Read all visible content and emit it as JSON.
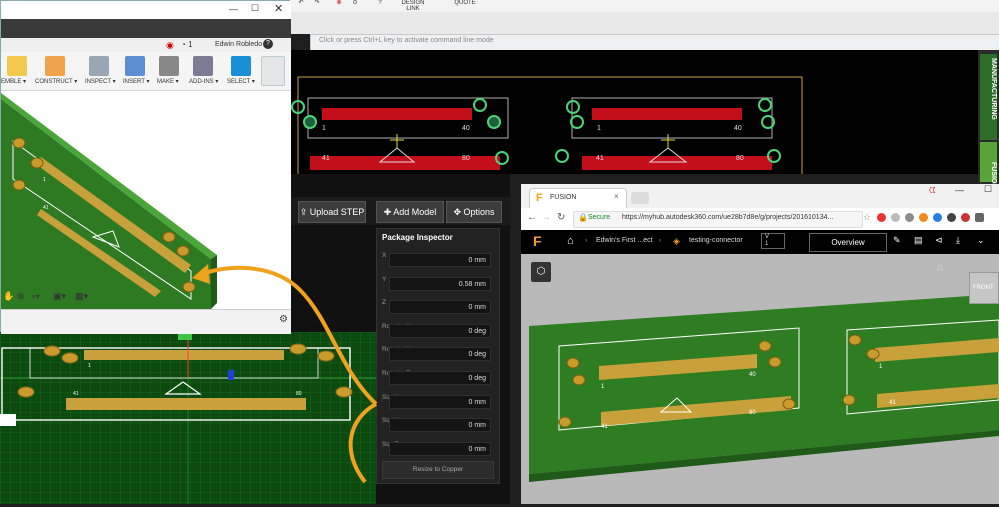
{
  "eagle": {
    "toolbar": {
      "design_link": "DESIGN\nLINK",
      "quote": "QUOTE"
    },
    "command_placeholder": "Click or press Ctrl+L key to activate command line mode",
    "board_pins_top": [
      "1",
      "40"
    ],
    "board_pins_bottom": [
      "41",
      "80"
    ],
    "side_tabs": {
      "manufacturing": "MANUFACTURING",
      "fusion": "FUSION"
    }
  },
  "fusion": {
    "user_name": "Edwin Robledo",
    "job_count": "1",
    "help": "?",
    "ribbon": [
      "EMBLE ▾",
      "CONSTRUCT ▾",
      "INSPECT ▾",
      "INSERT ▾",
      "MAKE ▾",
      "ADD-INS ▾",
      "SELECT ▾"
    ],
    "model_pins": {
      "a": "1",
      "b": "41",
      "c": "40",
      "d": "80"
    }
  },
  "upverter": {
    "buttons": {
      "upload_step": "Upload STEP",
      "add_model": "Add Model",
      "options": "Options"
    },
    "inspector": {
      "title": "Package Inspector",
      "fields": [
        {
          "label": "X",
          "value": "0 mm"
        },
        {
          "label": "Y",
          "value": "0.58 mm"
        },
        {
          "label": "Z",
          "value": "0 mm"
        },
        {
          "label": "RotationX",
          "value": "0 deg"
        },
        {
          "label": "RotationY",
          "value": "0 deg"
        },
        {
          "label": "RotationZ",
          "value": "0 deg"
        },
        {
          "label": "SizeX",
          "value": "0 mm"
        },
        {
          "label": "SizeY",
          "value": "0 mm"
        },
        {
          "label": "SizeZ",
          "value": "0 mm"
        }
      ],
      "resize_button": "Resize to Copper"
    },
    "board_pins": {
      "a": "41",
      "b": "80",
      "c": "1"
    }
  },
  "chrome": {
    "tab_title": "FUSION",
    "secure_label": "Secure",
    "url": "https://myhub.autodesk360.com/ue28b7d8e/g/projects/201610134...",
    "breadcrumb": {
      "project": "Edwin's First ...ect",
      "file": "testing-connector",
      "version": "V\n1"
    },
    "overview_button": "Overview",
    "view_cube_label": "FRONT",
    "model_pins": {
      "a": "1",
      "b": "40",
      "c": "41",
      "d": "80",
      "e": "1",
      "f": "41"
    }
  },
  "colors": {
    "pcb_green": "#2f7d22",
    "pad_gold": "#c89b2a",
    "accent_orange": "#f0a21c",
    "eagle_red": "#c40f1a"
  }
}
